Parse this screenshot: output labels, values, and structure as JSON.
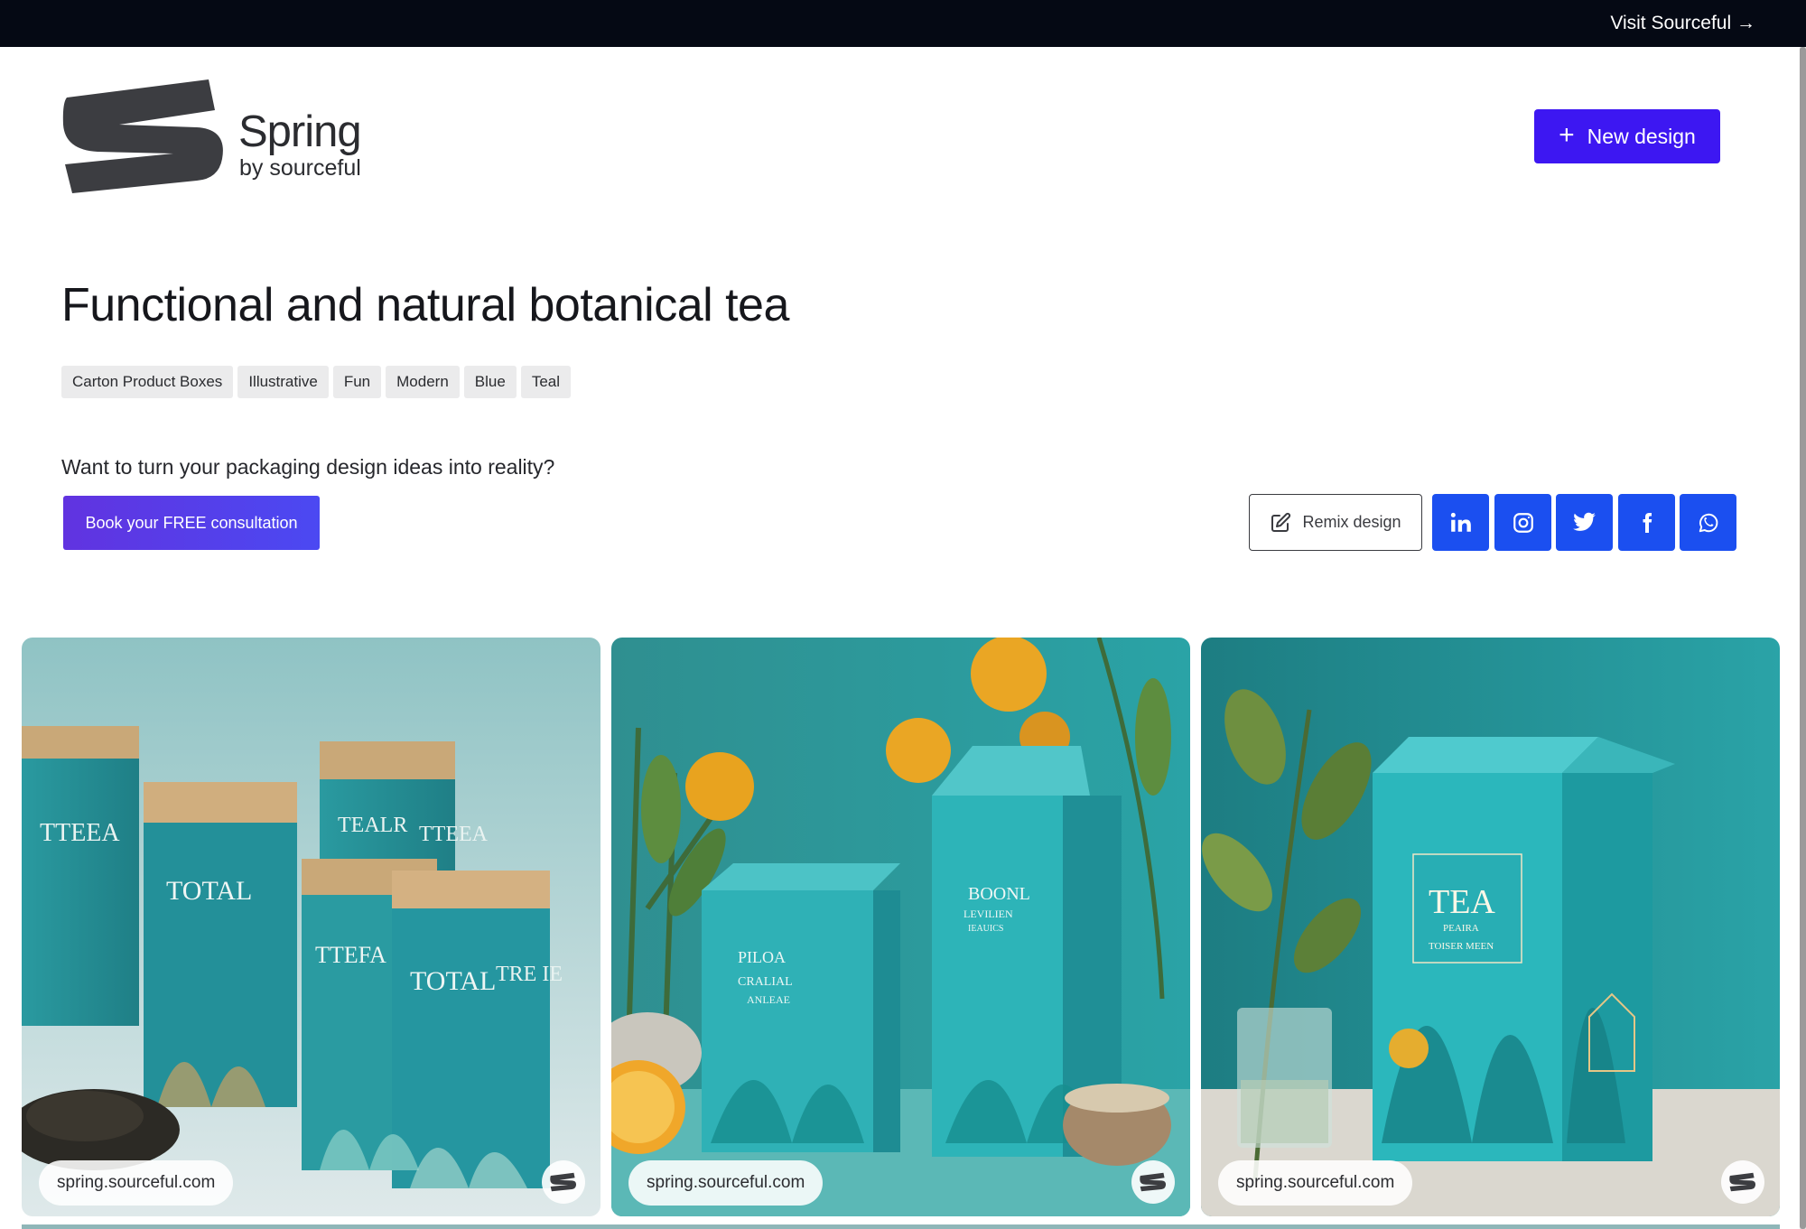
{
  "topbar": {
    "visit_label": "Visit Sourceful →"
  },
  "brand": {
    "name": "Spring",
    "subtitle": "by sourceful"
  },
  "header": {
    "new_design_label": "New design"
  },
  "page": {
    "title": "Functional and natural botanical tea",
    "tags": [
      "Carton Product Boxes",
      "Illustrative",
      "Fun",
      "Modern",
      "Blue",
      "Teal"
    ],
    "cta_text": "Want to turn your packaging design ideas into reality?",
    "consult_label": "Book your FREE consultation"
  },
  "actions": {
    "remix_label": "Remix design",
    "share": [
      {
        "name": "linkedin",
        "icon": "linkedin-icon"
      },
      {
        "name": "instagram",
        "icon": "instagram-icon"
      },
      {
        "name": "twitter",
        "icon": "twitter-icon"
      },
      {
        "name": "facebook",
        "icon": "facebook-icon"
      },
      {
        "name": "whatsapp",
        "icon": "whatsapp-icon"
      }
    ]
  },
  "gallery": [
    {
      "url_label": "spring.sourceful.com",
      "box_text": [
        "TTEEA",
        "TOTAL",
        "TEALR",
        "TTEEA",
        "TTEFA",
        "TOTAL",
        "TRE IE"
      ]
    },
    {
      "url_label": "spring.sourceful.com",
      "box_text": [
        "PILOA",
        "CRALIAL",
        "ANLEAE",
        "BOONL",
        "LEVILIEN",
        "IEAUICS"
      ]
    },
    {
      "url_label": "spring.sourceful.com",
      "box_text": [
        "TEA",
        "PEAIRA",
        "TOISER MEEN"
      ]
    }
  ],
  "colors": {
    "topbar": "#050914",
    "primary": "#3d17f2",
    "social": "#1b4ff0",
    "teal": "#2aa7ab"
  }
}
